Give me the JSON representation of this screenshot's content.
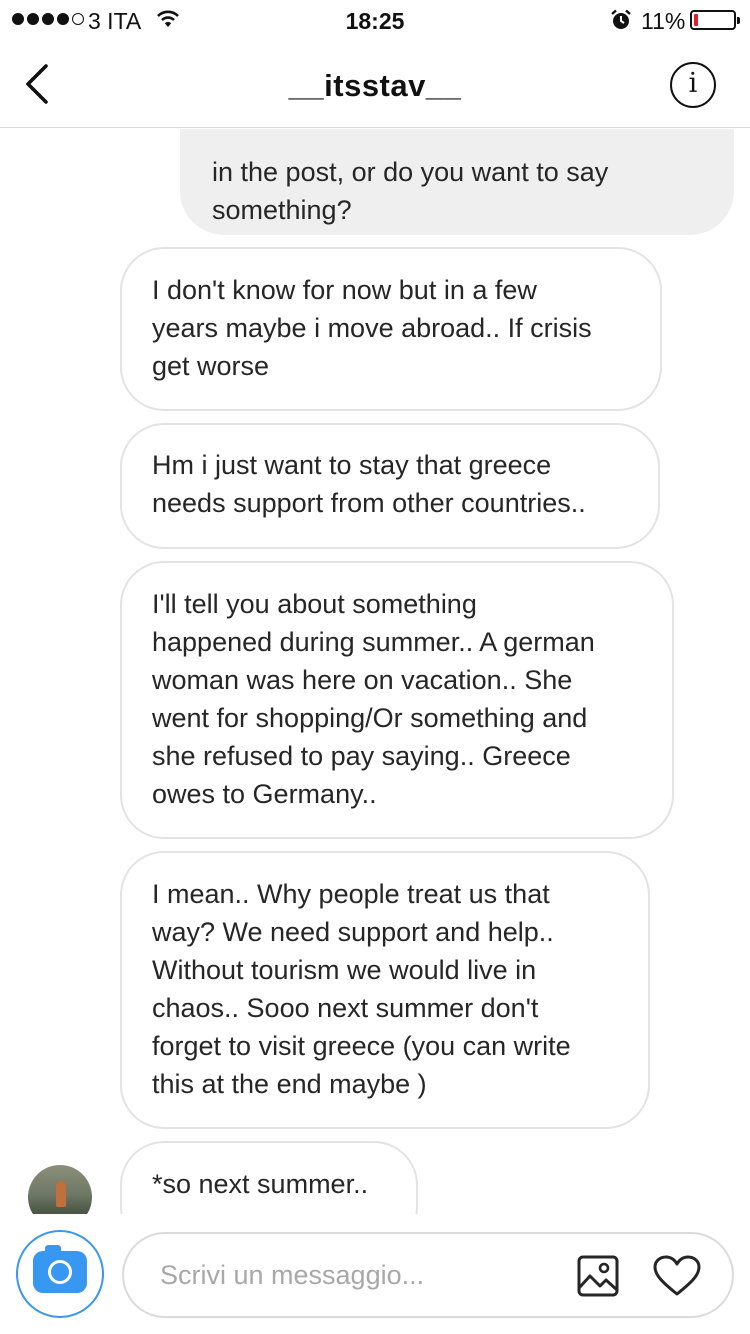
{
  "status_bar": {
    "carrier": "3 ITA",
    "time": "18:25",
    "battery_percent_label": "11%",
    "battery_level": 0.11,
    "signal_bars": 4,
    "signal_max": 5
  },
  "header": {
    "title": "__itsstav__",
    "back_icon": "chevron-left-icon",
    "info_icon": "info-icon"
  },
  "messages": [
    {
      "direction": "outgoing",
      "text": "in the post, or do you want to say\nsomething?"
    },
    {
      "direction": "incoming",
      "text": "I don't know for now but in a few\nyears maybe i move abroad.. If crisis\nget worse"
    },
    {
      "direction": "incoming",
      "text": "Hm i just want to stay that greece\nneeds support from other countries.."
    },
    {
      "direction": "incoming",
      "text": "I'll  tell you about something\nhappened during summer.. A german\nwoman was here on vacation.. She\nwent for shopping/Or something  and\nshe refused to pay saying.. Greece\nowes to Germany.."
    },
    {
      "direction": "incoming",
      "text": "I mean.. Why people treat us that\nway?  We need support and help..\nWithout tourism we would live in\nchaos.. Sooo next summer don't\nforget to visit greece (you can write\nthis at the end maybe )"
    },
    {
      "direction": "incoming",
      "text": "*so next summer.."
    }
  ],
  "composer": {
    "placeholder": "Scrivi un messaggio...",
    "camera_icon": "camera-icon",
    "gallery_icon": "gallery-icon",
    "like_icon": "heart-icon"
  },
  "colors": {
    "accent": "#3897f0",
    "outgoing_bubble": "#efefef",
    "incoming_border": "#e3e3e3",
    "battery_low": "#e0202a"
  }
}
